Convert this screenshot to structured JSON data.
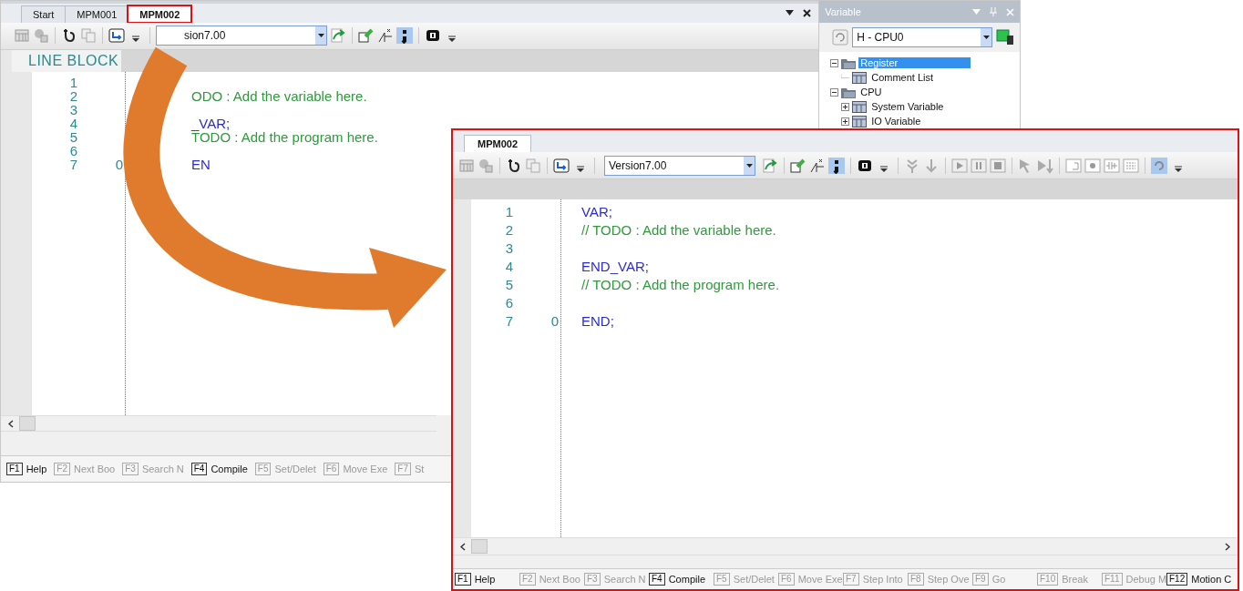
{
  "main_window": {
    "tabs": [
      {
        "label": "Start",
        "selected": false,
        "highlighted": false
      },
      {
        "label": "MPM001",
        "selected": false,
        "highlighted": false
      },
      {
        "label": "MPM002",
        "selected": true,
        "highlighted": true
      }
    ],
    "toolbar": {
      "version": "sion7.00"
    },
    "editor": {
      "header": "LINE BLOCK",
      "lines": [
        {
          "number": "1"
        },
        {
          "number": "2",
          "code": [
            {
              "kind": "comment",
              "text": "ODO : Add the variable here."
            }
          ]
        },
        {
          "number": "3"
        },
        {
          "number": "4",
          "code": [
            {
              "kind": "keyword",
              "text": "_VAR;"
            }
          ]
        },
        {
          "number": "5",
          "code": [
            {
              "kind": "comment",
              "text": "TODO : Add the program here."
            }
          ]
        },
        {
          "number": "6"
        },
        {
          "number": "7",
          "marker": "0",
          "code": [
            {
              "kind": "keyword",
              "text": "EN"
            }
          ]
        }
      ]
    },
    "function_keys": [
      {
        "key": "F1",
        "label": "Help",
        "disabled": false
      },
      {
        "key": "F2",
        "label": "Next Boo",
        "disabled": true
      },
      {
        "key": "F3",
        "label": "Search N",
        "disabled": true
      },
      {
        "key": "F4",
        "label": "Compile",
        "disabled": false
      },
      {
        "key": "F5",
        "label": "Set/Delet",
        "disabled": true
      },
      {
        "key": "F6",
        "label": "Move Exe",
        "disabled": true
      },
      {
        "key": "F7",
        "label": "St",
        "disabled": true
      }
    ]
  },
  "variable_panel": {
    "title": "Variable",
    "cpu": "H - CPU0",
    "tree": [
      {
        "label": "Register",
        "selected": true,
        "expanded": true,
        "children": [
          {
            "label": "Comment List",
            "selected": false
          }
        ]
      },
      {
        "label": "CPU",
        "selected": false,
        "expanded": true,
        "children": [
          {
            "label": "System Variable",
            "selected": false,
            "expanded": false
          },
          {
            "label": "IO Variable",
            "selected": false,
            "expanded": false
          }
        ]
      }
    ]
  },
  "zoom_window": {
    "tab": "MPM002",
    "toolbar": {
      "version": "Version7.00"
    },
    "editor": {
      "lines": [
        {
          "number": "1",
          "code": [
            {
              "kind": "keyword",
              "text": "VAR;"
            }
          ]
        },
        {
          "number": "2",
          "code": [
            {
              "kind": "comment",
              "text": "// TODO : Add the variable here."
            }
          ]
        },
        {
          "number": "3"
        },
        {
          "number": "4",
          "code": [
            {
              "kind": "keyword",
              "text": "END_VAR;"
            }
          ]
        },
        {
          "number": "5",
          "code": [
            {
              "kind": "comment",
              "text": "// TODO : Add the program here."
            }
          ]
        },
        {
          "number": "6"
        },
        {
          "number": "7",
          "marker": "0",
          "code": [
            {
              "kind": "keyword",
              "text": "END;"
            }
          ]
        }
      ]
    },
    "function_keys": [
      {
        "key": "F1",
        "label": "Help",
        "disabled": false
      },
      {
        "key": "F2",
        "label": "Next Boo",
        "disabled": true
      },
      {
        "key": "F3",
        "label": "Search N",
        "disabled": true
      },
      {
        "key": "F4",
        "label": "Compile",
        "disabled": false
      },
      {
        "key": "F5",
        "label": "Set/Delet",
        "disabled": true
      },
      {
        "key": "F6",
        "label": "Move Exe",
        "disabled": true
      },
      {
        "key": "F7",
        "label": "Step Into",
        "disabled": true
      },
      {
        "key": "F8",
        "label": "Step Ove",
        "disabled": true
      },
      {
        "key": "F9",
        "label": "Go",
        "disabled": true
      },
      {
        "key": "F10",
        "label": "Break",
        "disabled": true
      },
      {
        "key": "F11",
        "label": "Debug M",
        "disabled": true
      },
      {
        "key": "F12",
        "label": "Motion C",
        "disabled": false
      }
    ]
  }
}
